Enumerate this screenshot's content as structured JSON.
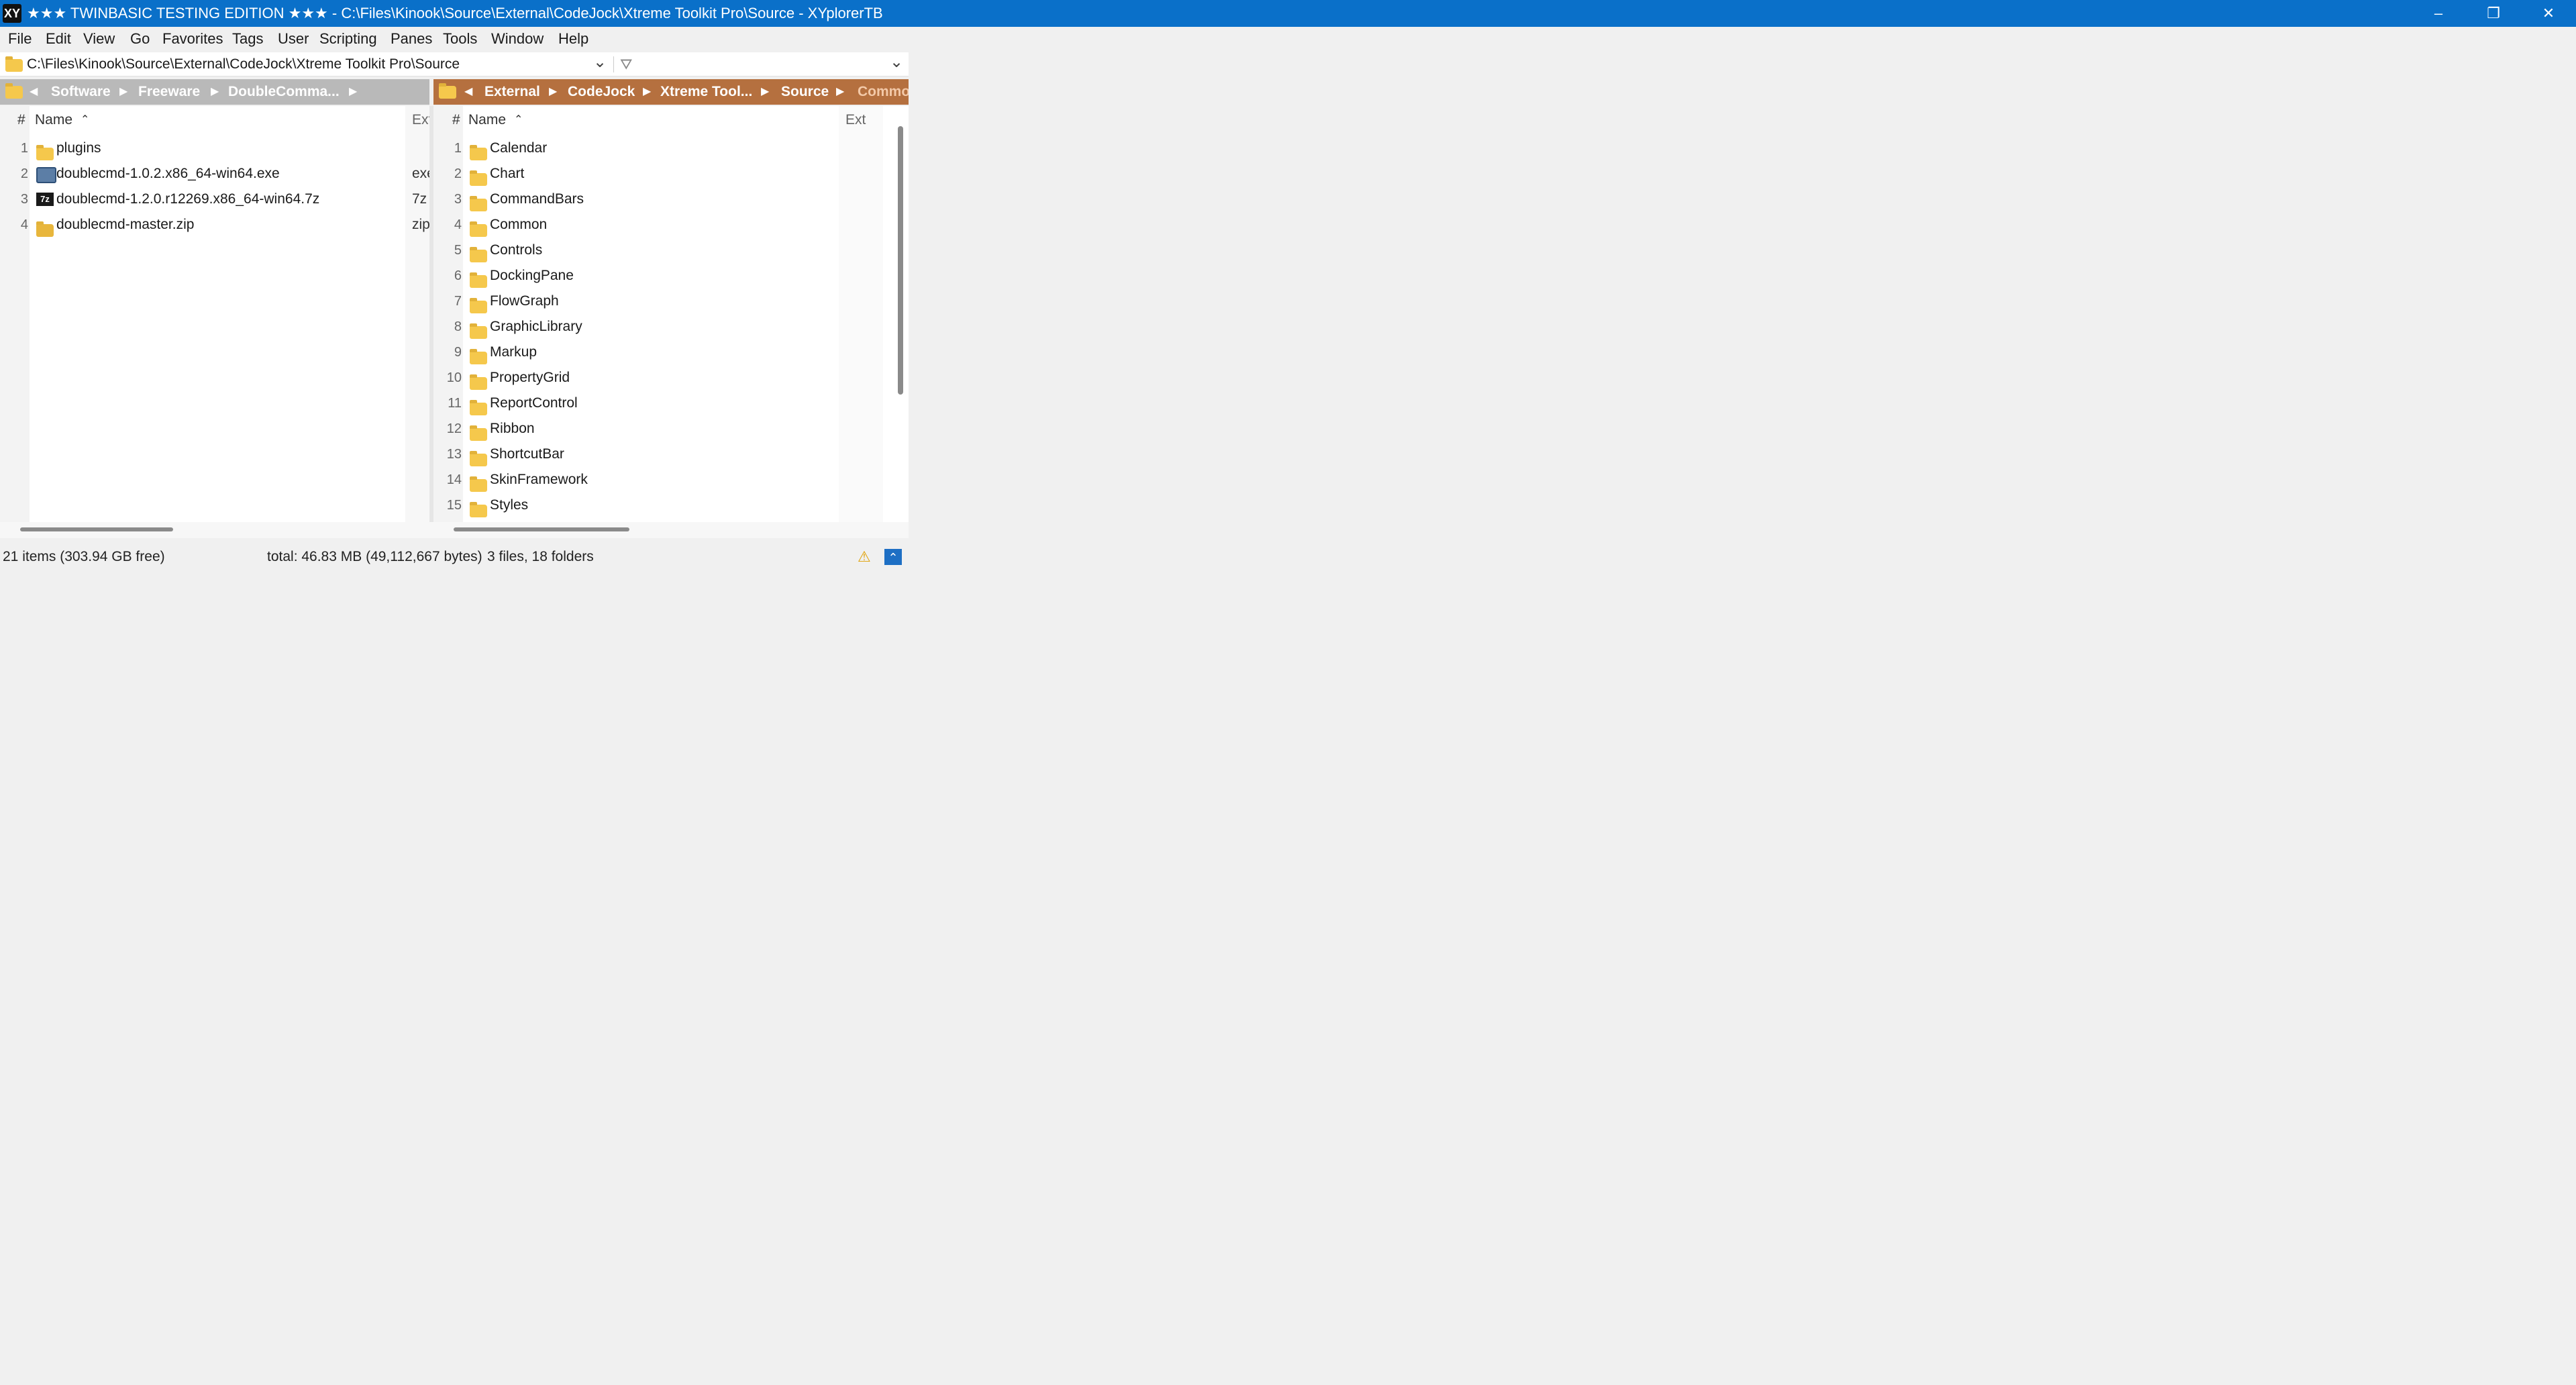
{
  "window": {
    "app_icon": "XY",
    "title": "★★★ TWINBASIC TESTING EDITION ★★★ - C:\\Files\\Kinook\\Source\\External\\CodeJock\\Xtreme Toolkit Pro\\Source - XYplorerTB",
    "minimize": "–",
    "restore": "❐",
    "close": "✕"
  },
  "menu": [
    "File",
    "Edit",
    "View",
    "Go",
    "Favorites",
    "Tags",
    "User",
    "Scripting",
    "Panes",
    "Tools",
    "Window",
    "Help"
  ],
  "address": {
    "path": "C:\\Files\\Kinook\\Source\\External\\CodeJock\\Xtreme Toolkit Pro\\Source",
    "dropdown": "⌄",
    "filter_icon": "⛛",
    "filter_dropdown": "⌄"
  },
  "left_pane": {
    "breadcrumbs": [
      "Software",
      "Freeware",
      "DoubleComma..."
    ],
    "header": {
      "num": "#",
      "name": "Name",
      "sort": "⌃",
      "ext": "Ext"
    },
    "rows": [
      {
        "num": "1",
        "name": "plugins",
        "ext": "",
        "icon": "folder-icon"
      },
      {
        "num": "2",
        "name": "doublecmd-1.0.2.x86_64-win64.exe",
        "ext": "exe",
        "icon": "exe-icon"
      },
      {
        "num": "3",
        "name": "doublecmd-1.2.0.r12269.x86_64-win64.7z",
        "ext": "7z",
        "icon": "7z-archive-icon"
      },
      {
        "num": "4",
        "name": "doublecmd-master.zip",
        "ext": "zip",
        "icon": "zip-folder-icon"
      }
    ]
  },
  "right_pane": {
    "breadcrumbs": [
      "External",
      "CodeJock",
      "Xtreme Tool...",
      "Source",
      "Commo"
    ],
    "header": {
      "num": "#",
      "name": "Name",
      "sort": "⌃",
      "ext": "Ext"
    },
    "rows": [
      {
        "num": "1",
        "name": "Calendar"
      },
      {
        "num": "2",
        "name": "Chart"
      },
      {
        "num": "3",
        "name": "CommandBars"
      },
      {
        "num": "4",
        "name": "Common"
      },
      {
        "num": "5",
        "name": "Controls"
      },
      {
        "num": "6",
        "name": "DockingPane"
      },
      {
        "num": "7",
        "name": "FlowGraph"
      },
      {
        "num": "8",
        "name": "GraphicLibrary"
      },
      {
        "num": "9",
        "name": "Markup"
      },
      {
        "num": "10",
        "name": "PropertyGrid"
      },
      {
        "num": "11",
        "name": "ReportControl"
      },
      {
        "num": "12",
        "name": "Ribbon"
      },
      {
        "num": "13",
        "name": "ShortcutBar"
      },
      {
        "num": "14",
        "name": "SkinFramework"
      },
      {
        "num": "15",
        "name": "Styles"
      }
    ]
  },
  "status": {
    "items": "21 items (303.94 GB free)",
    "total": "total: 46.83 MB (49,112,667 bytes)",
    "counts": "3 files, 18 folders",
    "warning_icon": "⚠",
    "toggle_icon": "⌃"
  },
  "colors": {
    "titlebar": "#0a70c9",
    "left_breadcrumb": "#b9b9b9",
    "right_breadcrumb": "#b5703f",
    "folder": "#f5c84c"
  }
}
